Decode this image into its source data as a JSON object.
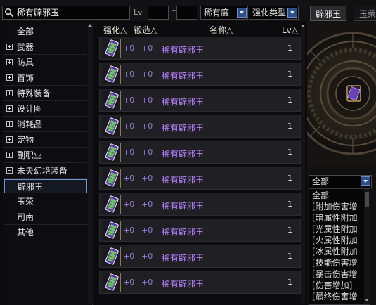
{
  "search": {
    "value": "稀有辟邪玉",
    "icon": "search-icon"
  },
  "filters": {
    "lv_label": "Lv",
    "lv_min": "",
    "lv_max": "",
    "lv_separator": "~",
    "rarity": {
      "selected": "稀有度"
    },
    "enhance_type": {
      "selected": "强化类型"
    }
  },
  "categories": [
    {
      "label": "全部",
      "kind": "plain"
    },
    {
      "label": "武器",
      "kind": "collapsed"
    },
    {
      "label": "防具",
      "kind": "collapsed"
    },
    {
      "label": "首饰",
      "kind": "collapsed"
    },
    {
      "label": "特殊装备",
      "kind": "collapsed"
    },
    {
      "label": "设计图",
      "kind": "collapsed"
    },
    {
      "label": "消耗品",
      "kind": "collapsed"
    },
    {
      "label": "宠物",
      "kind": "collapsed"
    },
    {
      "label": "副职业",
      "kind": "collapsed"
    },
    {
      "label": "未央幻境装备",
      "kind": "expanded"
    },
    {
      "label": "辟邪玉",
      "kind": "sub",
      "selected": true
    },
    {
      "label": "玉荣",
      "kind": "sub"
    },
    {
      "label": "司南",
      "kind": "sub"
    },
    {
      "label": "其他",
      "kind": "plain"
    }
  ],
  "columns": {
    "enhance": "强化△",
    "forge": "锻造△",
    "name": "名称△",
    "level": "Lv△"
  },
  "rows": [
    {
      "enhance": "+0",
      "forge": "+0",
      "name": "稀有辟邪玉",
      "level": "1"
    },
    {
      "enhance": "+0",
      "forge": "+0",
      "name": "稀有辟邪玉",
      "level": "1"
    },
    {
      "enhance": "+0",
      "forge": "+0",
      "name": "稀有辟邪玉",
      "level": "1"
    },
    {
      "enhance": "+0",
      "forge": "+0",
      "name": "稀有辟邪玉",
      "level": "1"
    },
    {
      "enhance": "+0",
      "forge": "+0",
      "name": "稀有辟邪玉",
      "level": "1"
    },
    {
      "enhance": "+0",
      "forge": "+0",
      "name": "稀有辟邪玉",
      "level": "1"
    },
    {
      "enhance": "+0",
      "forge": "+0",
      "name": "稀有辟邪玉",
      "level": "1"
    },
    {
      "enhance": "+0",
      "forge": "+0",
      "name": "稀有辟邪玉",
      "level": "1"
    },
    {
      "enhance": "+0",
      "forge": "+0",
      "name": "稀有辟邪玉",
      "level": "1"
    },
    {
      "enhance": "+0",
      "forge": "+0",
      "name": "稀有辟邪玉",
      "level": "1"
    }
  ],
  "right_panel": {
    "tabs": [
      {
        "label": "辟邪玉",
        "active": true
      },
      {
        "label": "玉荣",
        "active": false
      }
    ],
    "option_filter": {
      "selected": "全部"
    },
    "options": [
      "全部",
      "[附加伤害增",
      "[暗属性附加",
      "[光属性附加",
      "[火属性附加",
      "[冰属性附加",
      "[技能伤害增",
      "[暴击伤害增",
      "[伤害增加]",
      "[最终伤害增"
    ]
  },
  "colors": {
    "rare_name": "#b681ff",
    "enhance_value": "#9a7bd9",
    "accent_blue": "#2a4f8a",
    "selected_border": "#6d97d6"
  }
}
